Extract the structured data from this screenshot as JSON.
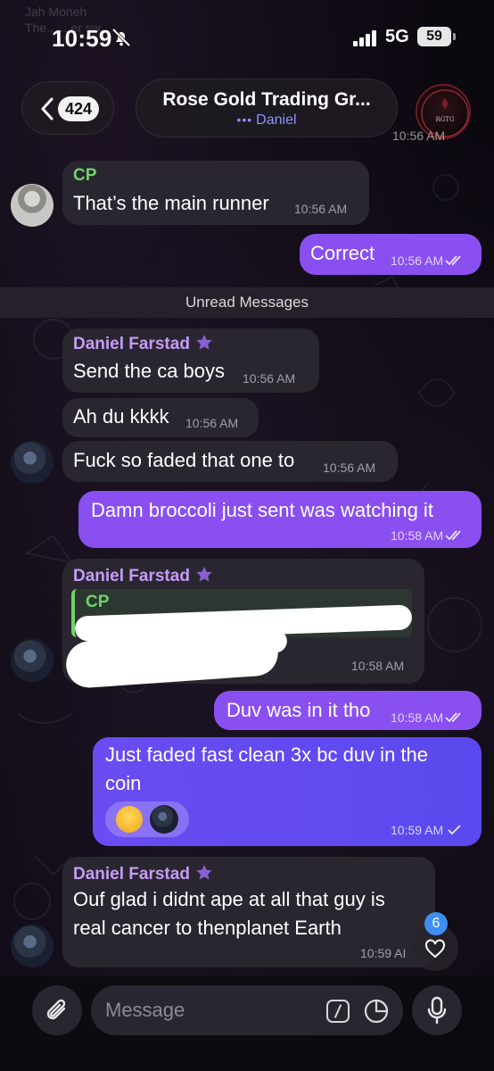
{
  "status_bar": {
    "time": "10:59",
    "network": "5G",
    "battery": "59",
    "ghost_notification_line1": "Jah Moneh",
    "ghost_notification_line2": "The... ...er sw..."
  },
  "header": {
    "back_count": "424",
    "title": "Rose Gold Trading Gr...",
    "subtitle": "Daniel",
    "avatar_text": "RGTG",
    "ghost_time": "10:56 AM"
  },
  "messages": [
    {
      "sender": "CP",
      "text": "That’s the main runner",
      "time": "10:56 AM"
    },
    {
      "text": "Correct",
      "time": "10:56 AM"
    },
    {
      "divider": "Unread Messages"
    },
    {
      "sender": "Daniel Farstad",
      "text": "Send the ca boys",
      "time": "10:56 AM"
    },
    {
      "text": "Ah du kkkk",
      "time": "10:56 AM"
    },
    {
      "text": "Fuck so faded that one to",
      "time": "10:56 AM"
    },
    {
      "text": "Damn broccoli just sent was watching it",
      "time": "10:58 AM"
    },
    {
      "sender": "Daniel Farstad",
      "reply_to": "CP",
      "time": "10:58 AM"
    },
    {
      "text": "Duv was in it tho",
      "time": "10:58 AM"
    },
    {
      "text_line1": "Just faded fast clean 3x bc duv in the",
      "text_line2": "coin",
      "time": "10:59 AM"
    },
    {
      "sender": "Daniel Farstad",
      "text_line1": "Ouf glad i didnt ape at all that guy is",
      "text_line2": "real cancer to thenplanet Earth",
      "time": "10:59 AI"
    }
  ],
  "scroll_badge": "6",
  "input": {
    "placeholder": "Message"
  },
  "colors": {
    "outgoing": "#8a4ff0",
    "incoming": "#2a2630",
    "cp_name": "#6fd36a",
    "daniel_name": "#c59cf6",
    "badge": "#3e8ef0"
  },
  "icons": [
    "bell-slash-icon",
    "signal-icon",
    "chevron-left-icon",
    "star-icon",
    "double-check-icon",
    "check-icon",
    "heart-icon",
    "paperclip-icon",
    "command-icon",
    "sticker-icon",
    "microphone-icon"
  ]
}
